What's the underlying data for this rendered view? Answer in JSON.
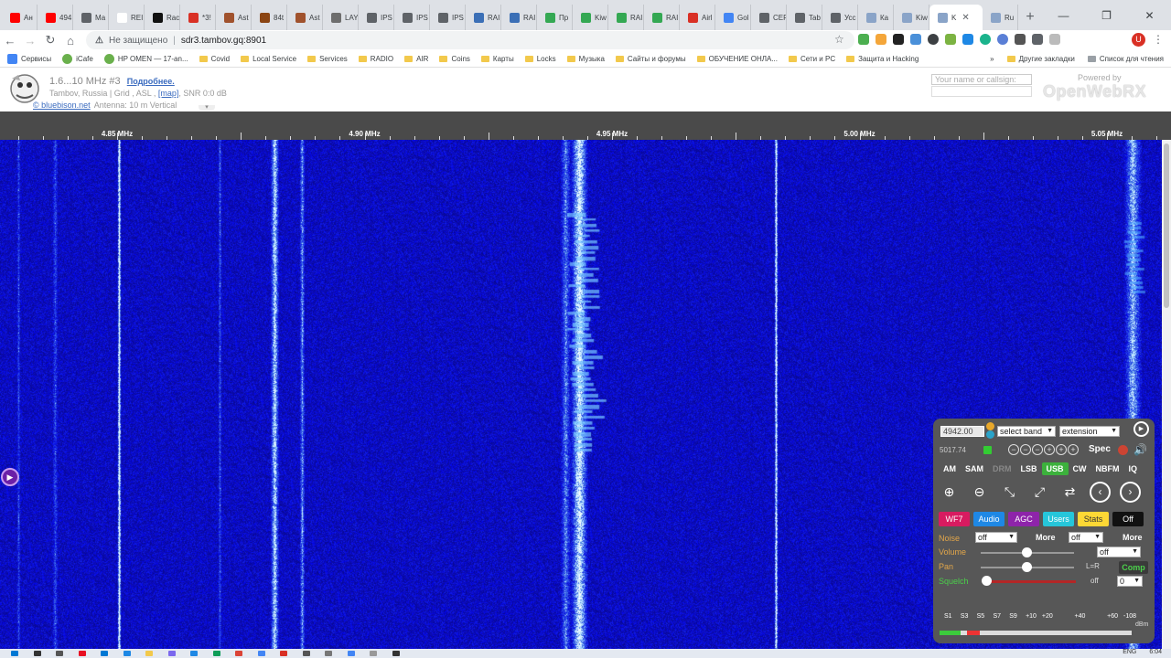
{
  "browser": {
    "tabs": [
      {
        "label": "Ан",
        "color": "#ff0000"
      },
      {
        "label": "494",
        "color": "#ff0000"
      },
      {
        "label": "Ма",
        "color": "#5f6368"
      },
      {
        "label": "REI",
        "color": "#ffffff"
      },
      {
        "label": "Rac",
        "color": "#111111"
      },
      {
        "label": "*3!",
        "color": "#d93025"
      },
      {
        "label": "Ast",
        "color": "#a0522d"
      },
      {
        "label": "84t",
        "color": "#8b4513"
      },
      {
        "label": "Ast",
        "color": "#a0522d"
      },
      {
        "label": "LAY",
        "color": "#6e6e6e"
      },
      {
        "label": "IPS",
        "color": "#5f6368"
      },
      {
        "label": "IPS",
        "color": "#5f6368"
      },
      {
        "label": "IPS",
        "color": "#5f6368"
      },
      {
        "label": "RAI",
        "color": "#3b6fb6"
      },
      {
        "label": "RAI",
        "color": "#3b6fb6"
      },
      {
        "label": "Пр",
        "color": "#34a853"
      },
      {
        "label": "Kiw",
        "color": "#34a853"
      },
      {
        "label": "RAI",
        "color": "#34a853"
      },
      {
        "label": "RAI",
        "color": "#34a853"
      },
      {
        "label": "Airl",
        "color": "#d93025"
      },
      {
        "label": "Gol",
        "color": "#4285f4"
      },
      {
        "label": "CEF",
        "color": "#5f6368"
      },
      {
        "label": "Tab",
        "color": "#5f6368"
      },
      {
        "label": "Усс",
        "color": "#5f6368"
      },
      {
        "label": "Ка",
        "color": "#8aa4c8"
      },
      {
        "label": "Kiw",
        "color": "#8aa4c8"
      },
      {
        "label": "K",
        "color": "#8aa4c8"
      },
      {
        "label": "Ru",
        "color": "#8aa4c8"
      }
    ],
    "new_tab": "+",
    "window_controls": {
      "minimize": "—",
      "restore": "❐",
      "close": "✕"
    },
    "insecure_label": "Не защищено",
    "url": "sdr3.tambov.gq:8901",
    "bookmarks": [
      {
        "label": "Сервисы",
        "kind": "apps"
      },
      {
        "label": "iCafe",
        "kind": "site"
      },
      {
        "label": "HP OMEN — 17-an...",
        "kind": "site"
      },
      {
        "label": "Covid",
        "kind": "folder"
      },
      {
        "label": "Local Service",
        "kind": "folder"
      },
      {
        "label": "Services",
        "kind": "folder"
      },
      {
        "label": "RADIO",
        "kind": "folder"
      },
      {
        "label": "AIR",
        "kind": "folder"
      },
      {
        "label": "Coins",
        "kind": "folder"
      },
      {
        "label": "Карты",
        "kind": "folder"
      },
      {
        "label": "Locks",
        "kind": "folder"
      },
      {
        "label": "Музыка",
        "kind": "folder"
      },
      {
        "label": "Сайты и форумы",
        "kind": "folder"
      },
      {
        "label": "ОБУЧЕНИЕ ОНЛА...",
        "kind": "folder"
      },
      {
        "label": "Сети и PC",
        "kind": "folder"
      },
      {
        "label": "Защита и Hacking",
        "kind": "folder"
      }
    ],
    "bookmarks_more": "»",
    "other_bookmarks": "Другие закладки",
    "reading_list": "Список для чтения",
    "profile_letter": "U"
  },
  "receiver": {
    "title": "1.6...10 MHz #3",
    "more_link": "Подробнее.",
    "location_prefix": "Tambov, Russia | Grid , ASL , ",
    "map_link": "[map]",
    "location_suffix": ", SNR 0:0 dB",
    "site_link": "© bluebison.net",
    "antenna": "Antenna: 10 m Vertical",
    "callsign_placeholder": "Your name or callsign:",
    "powered_by": "Powered by",
    "logo": "OpenWebRX"
  },
  "scale": {
    "labels": [
      "4.85 MHz",
      "4.90 MHz",
      "4.95 MHz",
      "5.00 MHz",
      "5.05 MHz"
    ]
  },
  "panel": {
    "frequency": "4942.00",
    "band_select": "select band",
    "extension_select": "extension",
    "frequency2": "5017.74",
    "spec_label": "Spec",
    "modes": [
      {
        "label": "AM",
        "state": "normal"
      },
      {
        "label": "SAM",
        "state": "normal"
      },
      {
        "label": "DRM",
        "state": "dim"
      },
      {
        "label": "LSB",
        "state": "normal"
      },
      {
        "label": "USB",
        "state": "on"
      },
      {
        "label": "CW",
        "state": "normal"
      },
      {
        "label": "NBFM",
        "state": "normal"
      },
      {
        "label": "IQ",
        "state": "normal"
      }
    ],
    "tabs": [
      {
        "label": "WF7",
        "bg": "#d81b60",
        "fg": "#ffffff"
      },
      {
        "label": "Audio",
        "bg": "#1e88e5",
        "fg": "#ffffff"
      },
      {
        "label": "AGC",
        "bg": "#8e24aa",
        "fg": "#ffffff"
      },
      {
        "label": "Users",
        "bg": "#26c6da",
        "fg": "#ffffff"
      },
      {
        "label": "Stats",
        "bg": "#fdd835",
        "fg": "#333333"
      },
      {
        "label": "Off",
        "bg": "#111111",
        "fg": "#ffffff"
      }
    ],
    "noise_label": "Noise",
    "noise_select": "off",
    "noise_more": "More",
    "noise2_select": "off",
    "noise2_more": "More",
    "volume_label": "Volume",
    "volume_select": "off",
    "volume_level": 0.5,
    "pan_label": "Pan",
    "pan_value": "L=R",
    "pan_level": 0.5,
    "comp_label": "Comp",
    "squelch_label": "Squelch",
    "squelch_state": "off",
    "squelch_select": "0",
    "squelch_level": 0.0,
    "smeter_labels": [
      "S1",
      "S3",
      "S5",
      "S7",
      "S9",
      "+10",
      "+20",
      "",
      "+40",
      "",
      "+60",
      "-108"
    ],
    "smeter_unit": "dBm",
    "smeter_level": 0.11
  },
  "taskbar": {
    "lang": "ENG",
    "time": "6:04"
  }
}
